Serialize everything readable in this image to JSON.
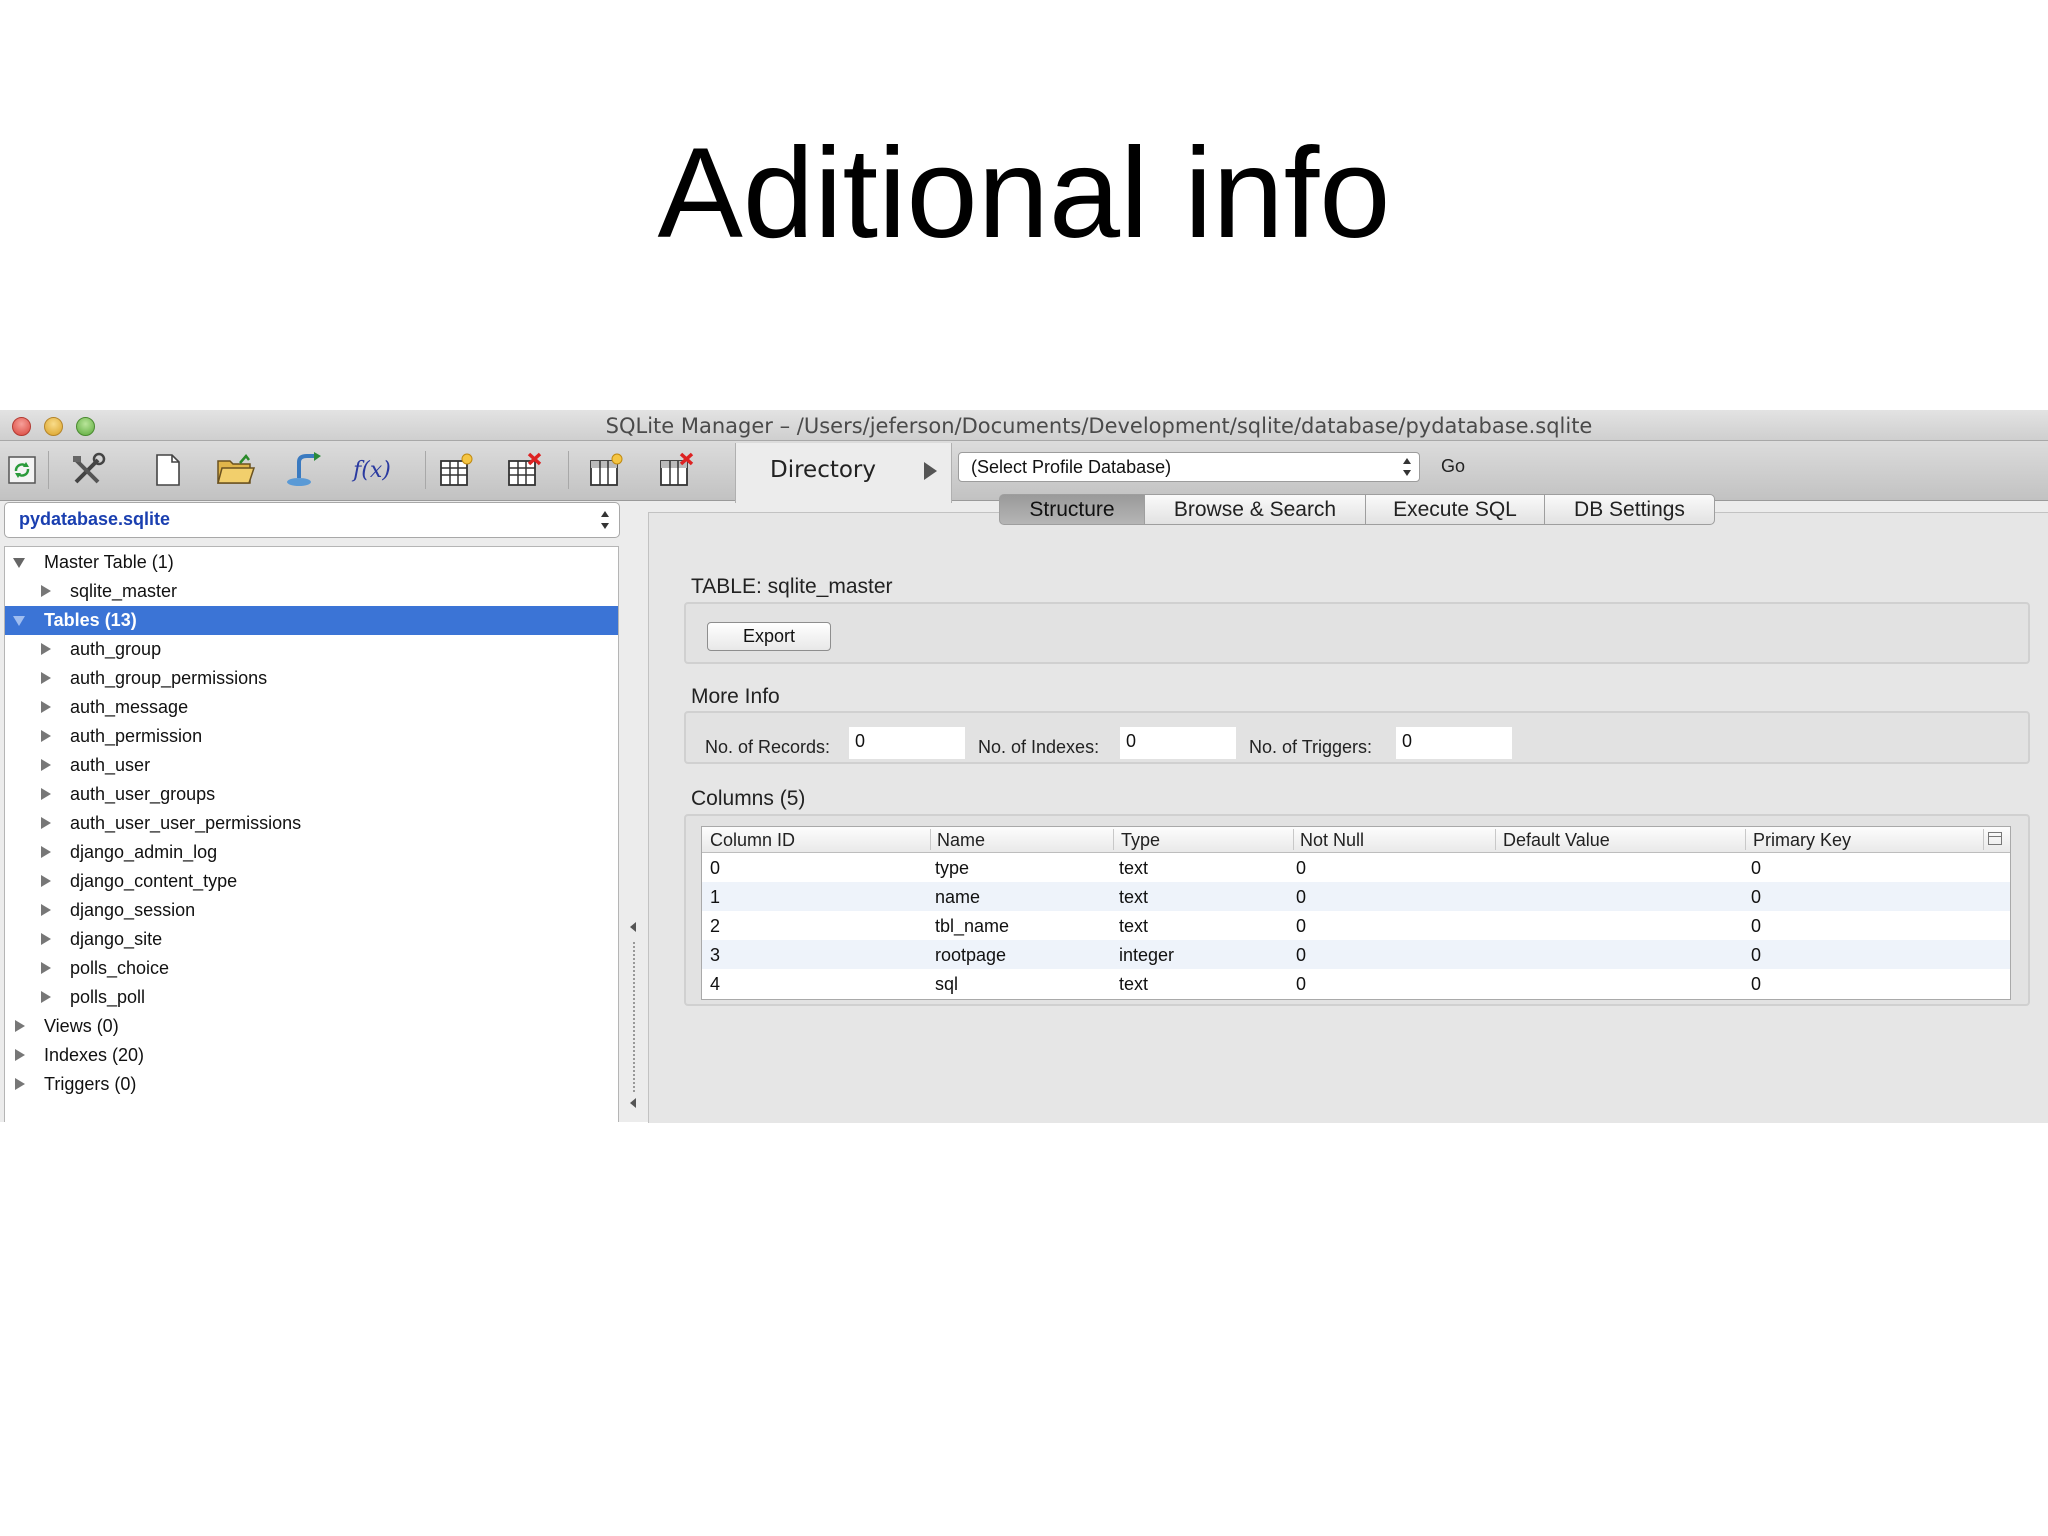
{
  "slide": {
    "title": "Aditional info"
  },
  "window": {
    "title": "SQLite Manager – /Users/jeferson/Documents/Development/sqlite/database/pydatabase.sqlite"
  },
  "toolbar": {
    "icons": [
      "refresh-icon",
      "tools-icon",
      "new-database-icon",
      "open-database-icon",
      "import-icon",
      "function-icon",
      "create-table-icon",
      "drop-table-icon",
      "create-index-icon",
      "drop-index-icon"
    ],
    "function_label": "f(x)",
    "directory_label": "Directory",
    "profile_select": "(Select Profile Database)",
    "go_label": "Go"
  },
  "sidebar": {
    "database": "pydatabase.sqlite",
    "master": {
      "label": "Master Table (1)",
      "items": [
        "sqlite_master"
      ]
    },
    "tables": {
      "label": "Tables (13)",
      "items": [
        "auth_group",
        "auth_group_permissions",
        "auth_message",
        "auth_permission",
        "auth_user",
        "auth_user_groups",
        "auth_user_user_permissions",
        "django_admin_log",
        "django_content_type",
        "django_session",
        "django_site",
        "polls_choice",
        "polls_poll"
      ]
    },
    "views": "Views (0)",
    "indexes": "Indexes (20)",
    "triggers": "Triggers (0)"
  },
  "tabs": [
    "Structure",
    "Browse & Search",
    "Execute SQL",
    "DB Settings"
  ],
  "main": {
    "table_label": "TABLE: sqlite_master",
    "export_label": "Export",
    "more_info_label": "More Info",
    "records_label": "No. of Records:",
    "records_value": "0",
    "indexes_label": "No. of Indexes:",
    "indexes_value": "0",
    "triggers_label": "No. of Triggers:",
    "triggers_value": "0",
    "columns_label": "Columns (5)"
  },
  "columns_table": {
    "headers": [
      "Column ID",
      "Name",
      "Type",
      "Not Null",
      "Default Value",
      "Primary Key"
    ],
    "rows": [
      [
        "0",
        "type",
        "text",
        "0",
        "",
        "0"
      ],
      [
        "1",
        "name",
        "text",
        "0",
        "",
        "0"
      ],
      [
        "2",
        "tbl_name",
        "text",
        "0",
        "",
        "0"
      ],
      [
        "3",
        "rootpage",
        "integer",
        "0",
        "",
        "0"
      ],
      [
        "4",
        "sql",
        "text",
        "0",
        "",
        "0"
      ]
    ]
  },
  "colors": {
    "selection": "#3b74d6",
    "db_name": "#1a3fb0"
  }
}
